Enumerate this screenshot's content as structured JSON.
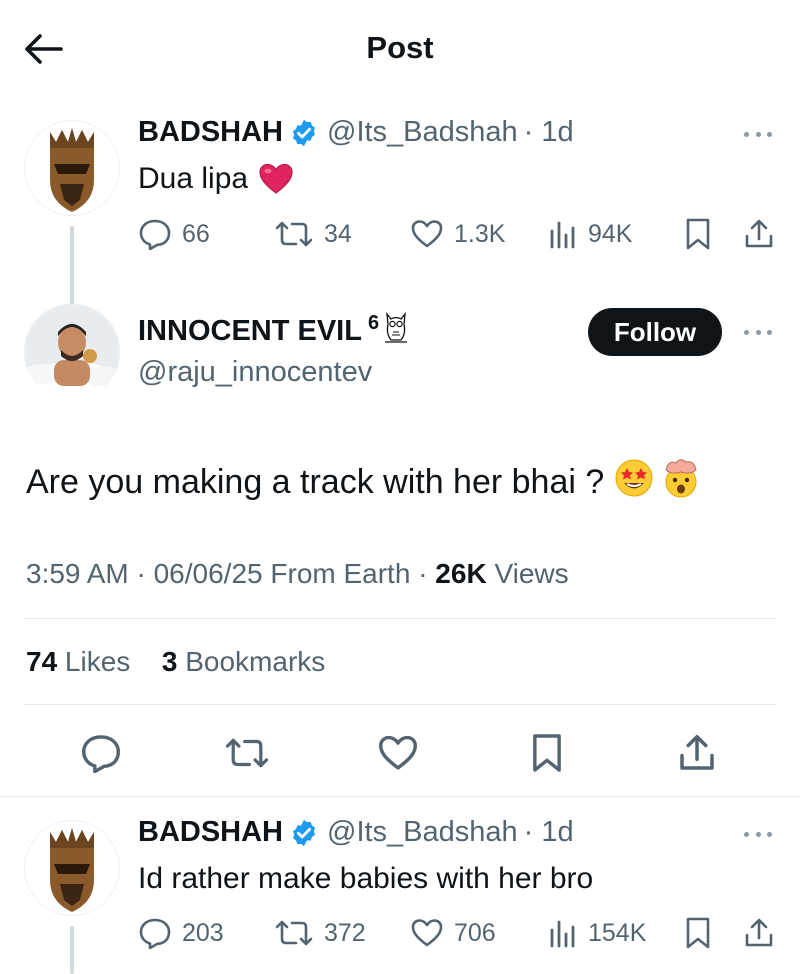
{
  "header": {
    "title": "Post",
    "back_icon": "arrow-left-icon"
  },
  "tweet1": {
    "name": "BADSHAH",
    "handle": "@Its_Badshah",
    "time": "· 1d",
    "text": "Dua lipa",
    "text_emoji": "red-heart-icon",
    "stats": {
      "replies": "66",
      "reposts": "34",
      "likes": "1.3K",
      "views": "94K"
    }
  },
  "main_tweet": {
    "name": "INNOCENT EVIL",
    "name_suffix": "6",
    "name_badge_icon": "owl-icon",
    "handle": "@raju_innocentev",
    "follow_label": "Follow",
    "text": "Are you making a track with her bhai ?",
    "emojis": [
      "star-struck-emoji-icon",
      "exploding-head-emoji-icon"
    ],
    "time": "3:59 AM · 06/06/25 From Earth · ",
    "views_count": "26K",
    "views_label": " Views",
    "likes_count": "74",
    "likes_label": " Likes",
    "bookmarks_count": "3",
    "bookmarks_label": " Bookmarks"
  },
  "reply": {
    "name": "BADSHAH",
    "handle": "@Its_Badshah",
    "time": "· 1d",
    "text": "Id rather make babies with her bro",
    "stats": {
      "replies": "203",
      "reposts": "372",
      "likes": "706",
      "views": "154K"
    }
  },
  "colors": {
    "verified": "#1d9bf0",
    "text": "#0f1419",
    "secondary": "#536471",
    "heart": "#e0245e"
  }
}
